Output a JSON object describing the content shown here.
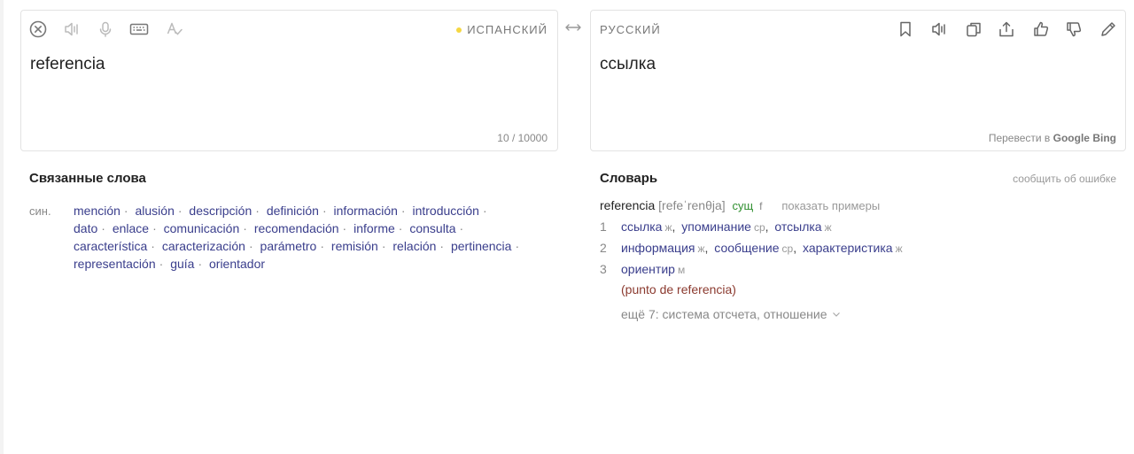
{
  "source": {
    "language": "ИСПАНСКИЙ",
    "text": "referencia",
    "counter": "10 / 10000"
  },
  "target": {
    "language": "РУССКИЙ",
    "text": "ссылка",
    "translate_prefix": "Перевести в",
    "engine_google": "Google",
    "engine_bing": "Bing"
  },
  "colors": {
    "accent_dot": "#f5d742",
    "link": "#3a3e8c",
    "pos": "#2f8f2f",
    "example": "#8b3a2f"
  },
  "icons": {
    "left_toolbar": [
      "clear-icon",
      "speaker-icon",
      "microphone-icon",
      "keyboard-icon",
      "spellcheck-icon"
    ],
    "right_toolbar": [
      "bookmark-icon",
      "speaker-icon",
      "copy-icon",
      "share-icon",
      "thumbs-up-icon",
      "thumbs-down-icon",
      "edit-icon"
    ],
    "swap": "swap-arrows-icon"
  },
  "related": {
    "title": "Связанные слова",
    "syn_label": "син.",
    "synonyms": [
      "mención",
      "alusión",
      "descripción",
      "definición",
      "información",
      "introducción",
      "dato",
      "enlace",
      "comunicación",
      "recomendación",
      "informe",
      "consulta",
      "característica",
      "caracterización",
      "parámetro",
      "remisión",
      "relación",
      "pertinencia",
      "representación",
      "guía",
      "orientador"
    ]
  },
  "dictionary": {
    "title": "Словарь",
    "report": "сообщить об ошибке",
    "headword": "referencia",
    "transcription": "[refeˈrenθja]",
    "pos": "сущ",
    "gender": "f",
    "show_examples": "показать примеры",
    "meanings": [
      {
        "num": "1",
        "words": [
          {
            "word": "ссылка",
            "gender": "ж"
          },
          {
            "word": "упоминание",
            "gender": "ср"
          },
          {
            "word": "отсылка",
            "gender": "ж"
          }
        ]
      },
      {
        "num": "2",
        "words": [
          {
            "word": "информация",
            "gender": "ж"
          },
          {
            "word": "сообщение",
            "gender": "ср"
          },
          {
            "word": "характеристика",
            "gender": "ж"
          }
        ]
      },
      {
        "num": "3",
        "words": [
          {
            "word": "ориентир",
            "gender": "м"
          }
        ],
        "example": "(punto de referencia)"
      }
    ],
    "more": "ещё 7: система отсчета, отношение"
  }
}
